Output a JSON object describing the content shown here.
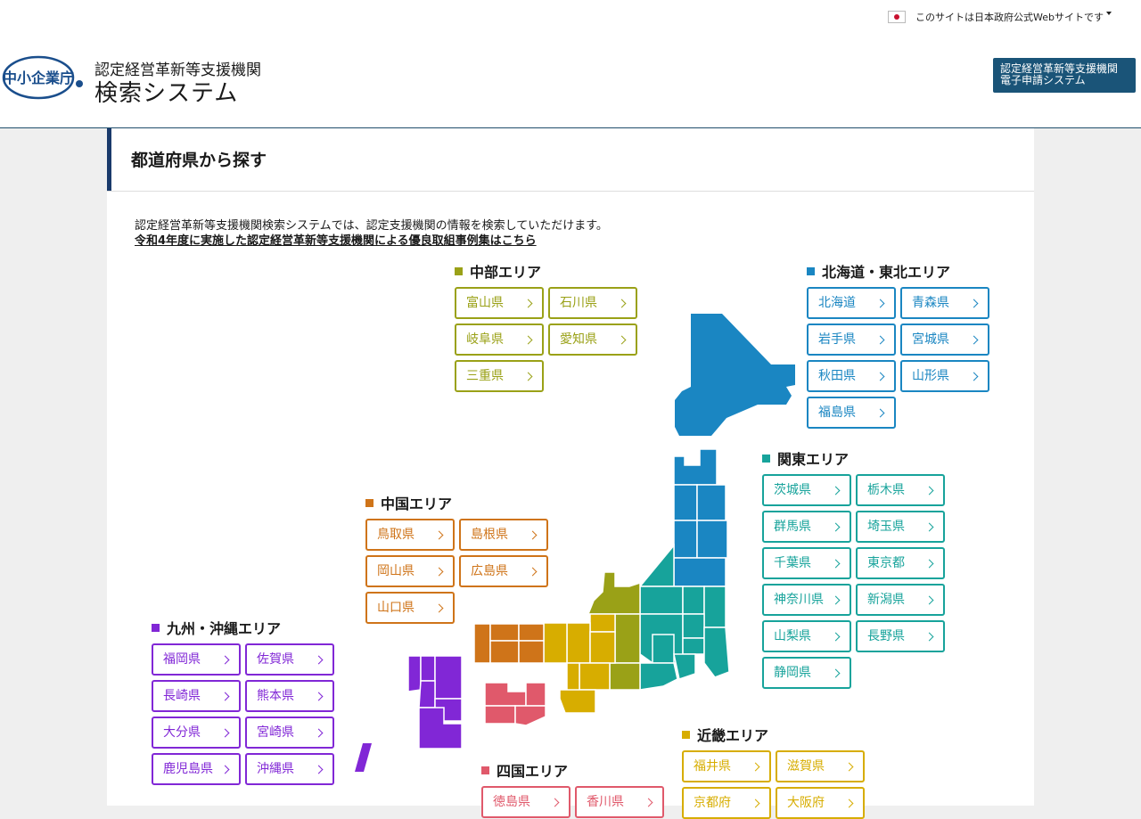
{
  "header": {
    "gov_notice": "このサイトは日本政府公式Webサイトです",
    "logo_mark_text": "中小企業庁",
    "title_line1": "認定経営革新等支援機関",
    "title_line2": "検索システム",
    "e_apply_line1": "認定経営革新等支援機関",
    "e_apply_line2": "電子申請システム"
  },
  "page": {
    "heading": "都道府県から探す",
    "intro": "認定経営革新等支援機関検索システムでは、認定支援機関の情報を検索していただけます。",
    "link": "令和4年度に実施した認定経営革新等支援機関による優良取組事例集はこちら"
  },
  "colors": {
    "chubu": "#9aa117",
    "hokkaido_tohoku": "#1a86c2",
    "kanto": "#17a39b",
    "chugoku": "#cf7419",
    "kyushu": "#8127d6",
    "shikoku": "#e0596b",
    "kinki": "#d7ad00"
  },
  "regions": {
    "chubu": {
      "title": "中部エリア",
      "prefs": [
        "富山県",
        "石川県",
        "岐阜県",
        "愛知県",
        "三重県"
      ]
    },
    "hokkaido_tohoku": {
      "title": "北海道・東北エリア",
      "prefs": [
        "北海道",
        "青森県",
        "岩手県",
        "宮城県",
        "秋田県",
        "山形県",
        "福島県"
      ]
    },
    "kanto": {
      "title": "関東エリア",
      "prefs": [
        "茨城県",
        "栃木県",
        "群馬県",
        "埼玉県",
        "千葉県",
        "東京都",
        "神奈川県",
        "新潟県",
        "山梨県",
        "長野県",
        "静岡県"
      ]
    },
    "chugoku": {
      "title": "中国エリア",
      "prefs": [
        "鳥取県",
        "島根県",
        "岡山県",
        "広島県",
        "山口県"
      ]
    },
    "kyushu": {
      "title": "九州・沖縄エリア",
      "prefs": [
        "福岡県",
        "佐賀県",
        "長崎県",
        "熊本県",
        "大分県",
        "宮崎県",
        "鹿児島県",
        "沖縄県"
      ]
    },
    "shikoku": {
      "title": "四国エリア",
      "prefs": [
        "徳島県",
        "香川県"
      ]
    },
    "kinki": {
      "title": "近畿エリア",
      "prefs": [
        "福井県",
        "滋賀県",
        "京都府",
        "大阪府"
      ]
    }
  }
}
